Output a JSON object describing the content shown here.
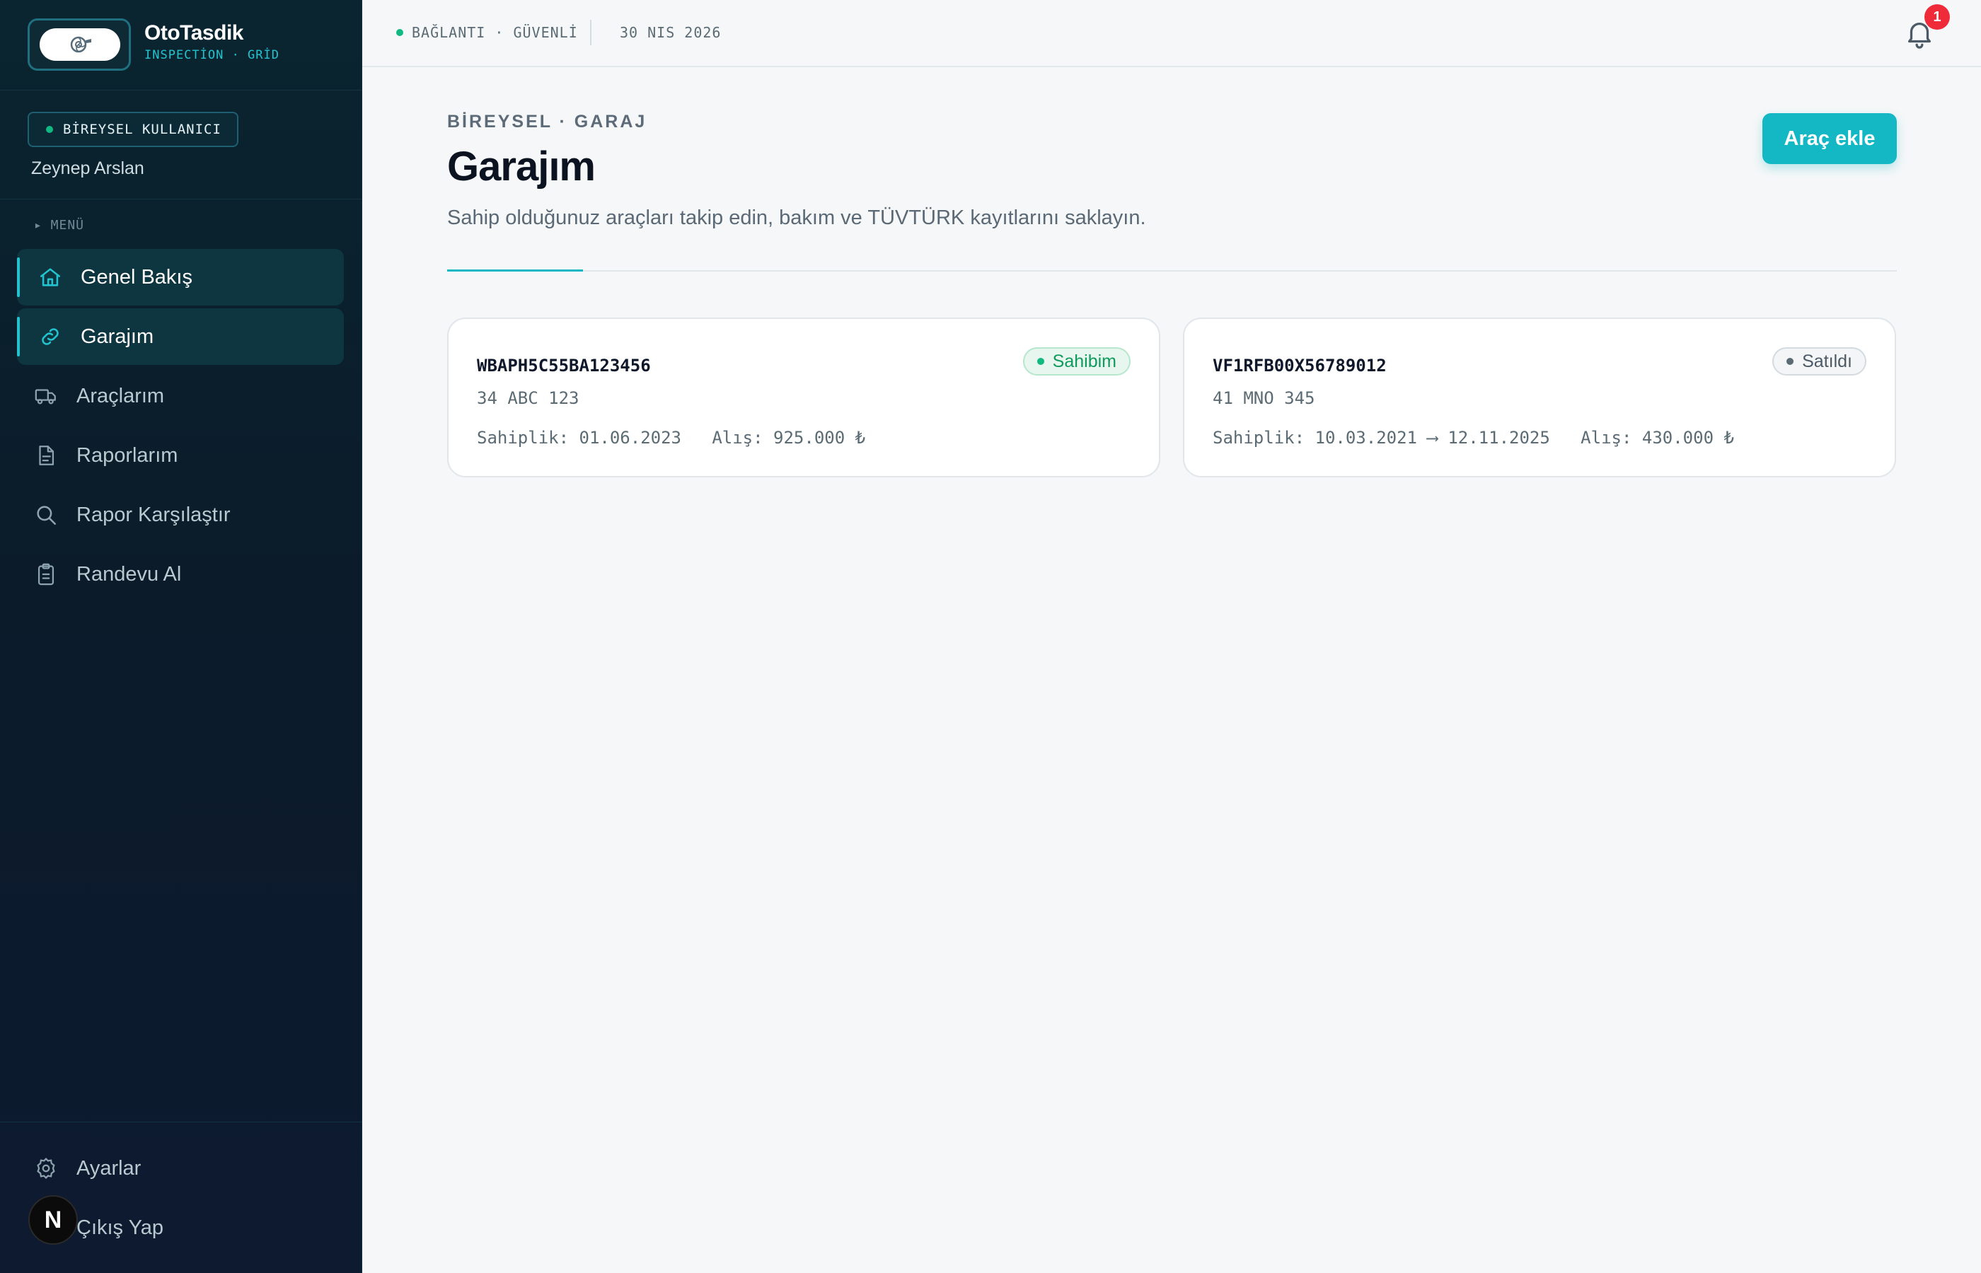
{
  "brand": {
    "name": "OtoTasdik",
    "subtitle": "INSPECTİON · GRİD"
  },
  "user": {
    "role": "BİREYSEL KULLANICI",
    "name": "Zeynep Arslan"
  },
  "menu": {
    "heading": "▸ MENÜ",
    "items": [
      {
        "label": "Genel Bakış",
        "icon": "home-icon",
        "active": true
      },
      {
        "label": "Garajım",
        "icon": "link-icon",
        "active": true
      },
      {
        "label": "Araçlarım",
        "icon": "truck-icon",
        "active": false
      },
      {
        "label": "Raporlarım",
        "icon": "file-icon",
        "active": false
      },
      {
        "label": "Rapor Karşılaştır",
        "icon": "search-icon",
        "active": false
      },
      {
        "label": "Randevu Al",
        "icon": "clipboard-icon",
        "active": false
      }
    ]
  },
  "footer": {
    "settings": "Ayarlar",
    "logout": "Çıkış Yap",
    "avatar_letter": "N"
  },
  "topbar": {
    "connection": "BAĞLANTI · GÜVENLİ",
    "date": "30 NIS 2026",
    "notifications": "1"
  },
  "page": {
    "eyebrow": "BİREYSEL · GARAJ",
    "title": "Garajım",
    "description": "Sahip olduğunuz araçları takip edin, bakım ve TÜVTÜRK kayıtlarını saklayın.",
    "add_button": "Araç ekle"
  },
  "vehicles": [
    {
      "vin": "WBAPH5C55BA123456",
      "plate": "34 ABC 123",
      "meta": "Sahiplik: 01.06.2023   Alış: 925.000 ₺",
      "status": "Sahibim"
    },
    {
      "vin": "VF1RFB00X56789012",
      "plate": "41 MNO 345",
      "meta": "Sahiplik: 10.03.2021 ⟶ 12.11.2025   Alış: 430.000 ₺",
      "status": "Satıldı"
    }
  ],
  "colors": {
    "accent": "#14b8c5",
    "sidebar": "#0b1b2a",
    "owned": "#0f9a5c",
    "badge": "#ef2b3a"
  }
}
